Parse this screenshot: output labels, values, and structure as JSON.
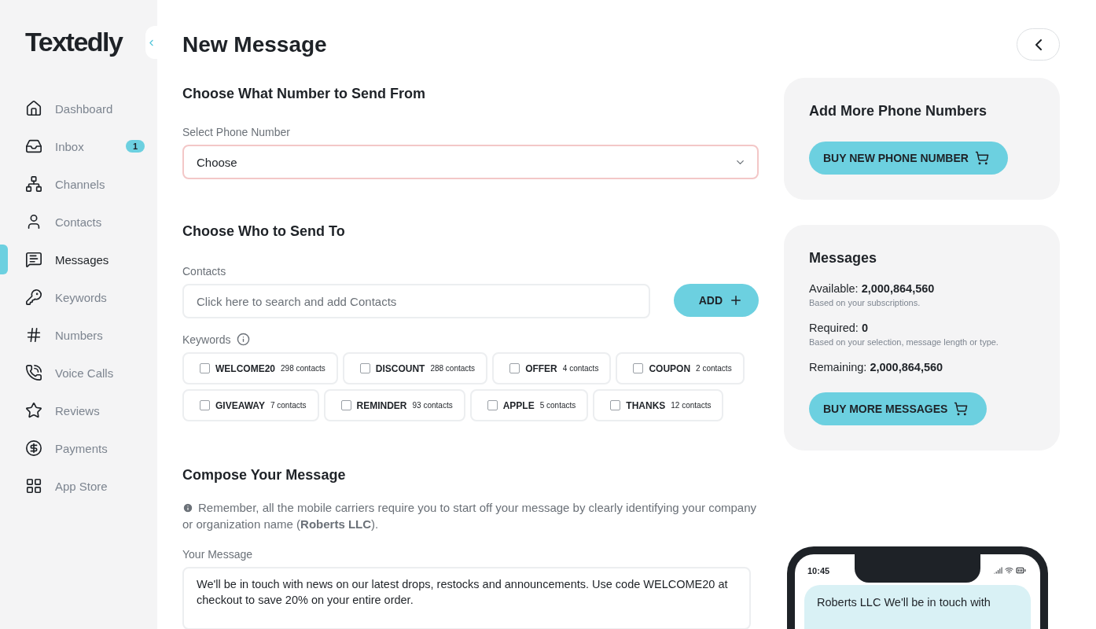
{
  "sidebar": {
    "logo": "Textedly",
    "items": [
      {
        "label": "Dashboard",
        "selected": false
      },
      {
        "label": "Inbox",
        "selected": false,
        "badge": "1"
      },
      {
        "label": "Channels",
        "selected": false
      },
      {
        "label": "Contacts",
        "selected": false
      },
      {
        "label": "Messages",
        "selected": true
      },
      {
        "label": "Keywords",
        "selected": false
      },
      {
        "label": "Numbers",
        "selected": false
      },
      {
        "label": "Voice Calls",
        "selected": false
      },
      {
        "label": "Reviews",
        "selected": false
      },
      {
        "label": "Payments",
        "selected": false
      },
      {
        "label": "App Store",
        "selected": false
      }
    ]
  },
  "page": {
    "title": "New Message"
  },
  "sender": {
    "heading": "Choose What Number to Send From",
    "label": "Select Phone Number",
    "value": "Choose"
  },
  "recipients": {
    "heading": "Choose Who to Send To",
    "contacts_label": "Contacts",
    "contacts_placeholder": "Click here to search and add Contacts",
    "add_button": "ADD",
    "keywords_label": "Keywords",
    "keywords": [
      {
        "name": "WELCOME20",
        "count": "298 contacts",
        "checked": false
      },
      {
        "name": "DISCOUNT",
        "count": "288 contacts",
        "checked": false
      },
      {
        "name": "OFFER",
        "count": "4 contacts",
        "checked": false
      },
      {
        "name": "COUPON",
        "count": "2 contacts",
        "checked": false
      },
      {
        "name": "GIVEAWAY",
        "count": "7 contacts",
        "checked": false
      },
      {
        "name": "REMINDER",
        "count": "93 contacts",
        "checked": false
      },
      {
        "name": "APPLE",
        "count": "5 contacts",
        "checked": false
      },
      {
        "name": "THANKS",
        "count": "12 contacts",
        "checked": false
      }
    ]
  },
  "compose": {
    "heading": "Compose Your Message",
    "note": "Remember, all the mobile carriers require you to start off your message by clearly identifying your company or organization name (**Roberts LLC**).",
    "message_label": "Your Message",
    "message": "We'll be in touch with news on our latest drops, restocks and announcements. Use code WELCOME20 at checkout to save 20% on your entire order."
  },
  "numbers_card": {
    "heading": "Add More Phone Numbers",
    "button": "BUY NEW PHONE NUMBER"
  },
  "messages_card": {
    "heading": "Messages",
    "stats": [
      {
        "label": "Available:",
        "value": "2,000,864,560",
        "hint": "Based on your subscriptions."
      },
      {
        "label": "Required:",
        "value": "0",
        "hint": "Based on your selection, message length or type."
      },
      {
        "label": "Remaining:",
        "value": "2,000,864,560"
      }
    ],
    "button": "BUY MORE MESSAGES"
  },
  "phone_preview": {
    "time": "10:45",
    "bubble": "Roberts LLC We'll be in touch with"
  }
}
